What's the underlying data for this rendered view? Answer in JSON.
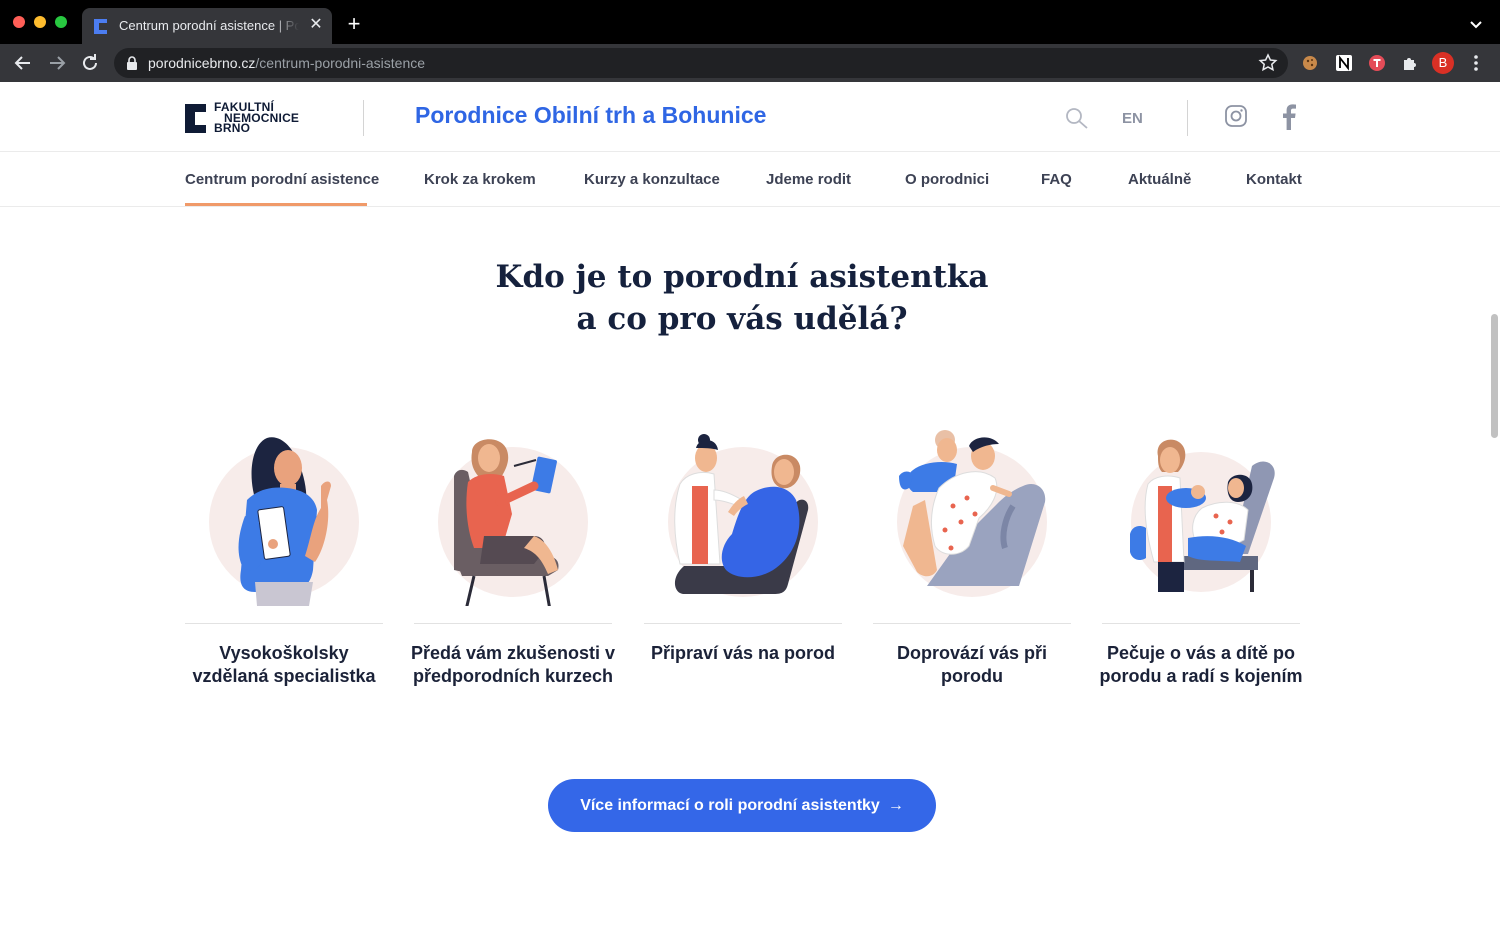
{
  "browser": {
    "tab_title": "Centrum porodní asistence | Porodnice Obilní trh a Bohunice",
    "url_domain": "porodnicebrno.cz",
    "url_path": "/centrum-porodni-asistence",
    "profile_initial": "B"
  },
  "header": {
    "logo_lines": [
      "FAKULTNÍ",
      "NEMOCNICE",
      "BRNO"
    ],
    "site_title": "Porodnice Obilní trh a Bohunice",
    "lang": "EN",
    "accent_color": "#2f66e4"
  },
  "nav": {
    "items": [
      {
        "label": "Centrum porodní asistence",
        "active": true
      },
      {
        "label": "Krok za krokem"
      },
      {
        "label": "Kurzy a konzultace"
      },
      {
        "label": "Jdeme rodit"
      },
      {
        "label": "O porodnici"
      },
      {
        "label": "FAQ"
      },
      {
        "label": "Aktuálně"
      },
      {
        "label": "Kontakt"
      }
    ],
    "active_underline_color": "#f09a69"
  },
  "main": {
    "heading_line1": "Kdo je to porodní asistentka",
    "heading_line2": "a co pro vás udělá?",
    "cards": [
      {
        "text": "Vysokoškolsky vzdělaná specialistka"
      },
      {
        "text": "Předá vám zkušenosti v předporodních kurzech"
      },
      {
        "text": "Připraví vás na porod"
      },
      {
        "text": "Doprovází vás při porodu"
      },
      {
        "text": "Pečuje o vás a dítě po porodu a radí s kojením"
      }
    ],
    "cta_label": "Více informací o roli porodní asistentky",
    "cta_arrow": "→"
  }
}
